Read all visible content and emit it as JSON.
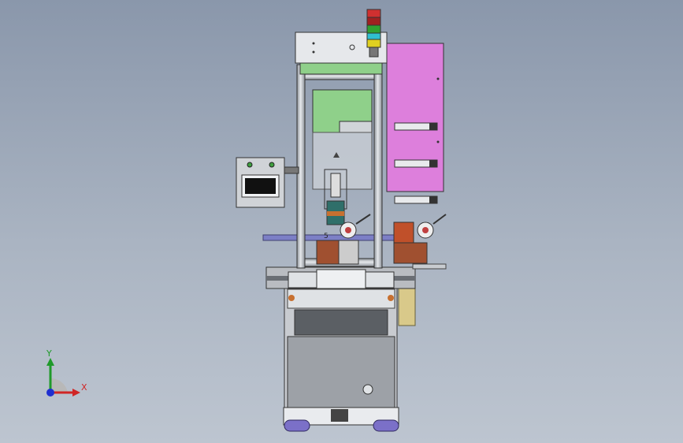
{
  "viewport": {
    "name": "cad-3d-viewport",
    "background_top": "#8a97ab",
    "background_bottom": "#bdc5d0"
  },
  "triad": {
    "y_label": "Y",
    "x_label": "X",
    "colors": {
      "x": "#d02525",
      "y": "#1f9a2a",
      "z": "#1f2fd0"
    }
  },
  "model": {
    "signal_tower_colors": [
      "#d03030",
      "#30a030",
      "#30c0d0",
      "#e0d020"
    ],
    "side_panel_color": "#dd7fdc",
    "guard_panel_color": "#8fd08a",
    "console_screen_color": "#d8dde2",
    "part_marker": "5"
  }
}
